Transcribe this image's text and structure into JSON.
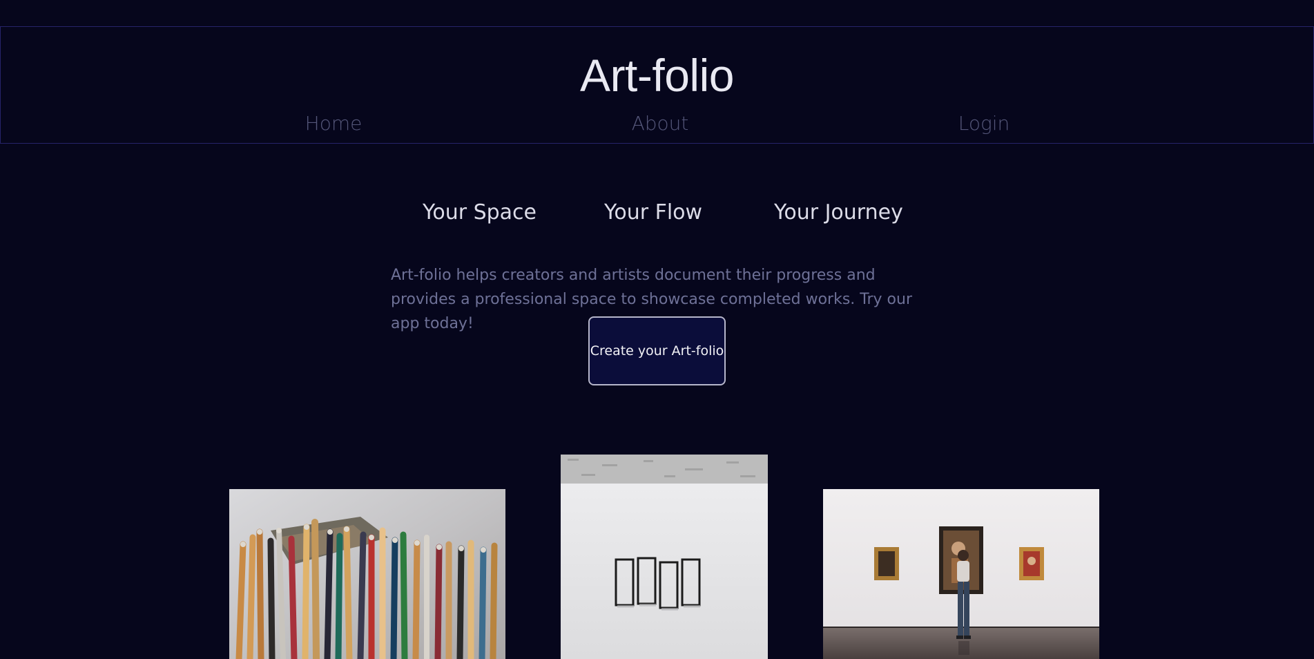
{
  "header": {
    "brand": "Art-folio",
    "nav": {
      "home": "Home",
      "about": "About",
      "login": "Login"
    }
  },
  "hero": {
    "taglines": [
      "Your Space",
      "Your Flow",
      "Your Journey"
    ],
    "description": "Art-folio helps creators and artists document their progress and provides a professional space to showcase completed works. Try our app today!",
    "cta_label": "Create your Art-folio"
  },
  "gallery": {
    "images": [
      {
        "icon": "paint-brushes-photo"
      },
      {
        "icon": "empty-frames-wall-photo"
      },
      {
        "icon": "gallery-visitor-photo"
      }
    ]
  },
  "colors": {
    "background": "#06061c",
    "header_border": "#26236a",
    "nav_text": "#55577a",
    "body_text": "#6e7197",
    "button_bg": "#0b0d3a",
    "button_border": "#b7b7cb"
  }
}
